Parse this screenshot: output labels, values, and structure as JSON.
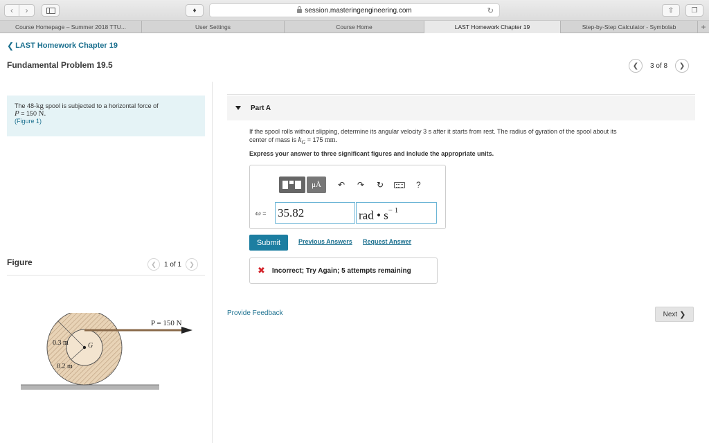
{
  "browser": {
    "url": "session.masteringengineering.com",
    "tabs": [
      {
        "label": "Course Homepage – Summer 2018 TTU..."
      },
      {
        "label": "User Settings"
      },
      {
        "label": "Course Home"
      },
      {
        "label": "LAST Homework Chapter 19"
      },
      {
        "label": "Step-by-Step Calculator - Symbolab"
      }
    ],
    "new_tab_label": "+"
  },
  "header": {
    "back_link": "LAST Homework Chapter 19",
    "title": "Fundamental Problem 19.5",
    "pager_text": "3 of 8"
  },
  "problem": {
    "line1_pre": "The 48-",
    "line1_unit": "kg",
    "line1_post": " spool is subjected to a horizontal force of",
    "line2_var": "P",
    "line2_post": " = 150 ",
    "line2_unit": "N.",
    "figure_link": "(Figure 1)"
  },
  "figure": {
    "label": "Figure",
    "pager_text": "1 of 1",
    "labels": {
      "force": "P = 150 N",
      "outer_radius": "0.3 m",
      "inner_radius": "0.2 m",
      "center": "G"
    }
  },
  "part": {
    "label": "Part A",
    "question_line1": "If the spool rolls without slipping, determine its angular velocity 3 s after it starts from rest. The radius of gyration of the spool about its",
    "question_line2_pre": "center of mass is ",
    "question_var": "k",
    "question_sub": "G",
    "question_eq": " = 175 ",
    "question_unit": "mm.",
    "instruction": "Express your answer to three significant figures and include the appropriate units.",
    "answer": {
      "var_label": "ω",
      "equals": " =",
      "value": "35.82",
      "unit_main": "rad • s",
      "unit_exp": "− 1"
    },
    "tool_mu_label": "μÅ",
    "help_label": "?",
    "submit_label": "Submit",
    "previous_answers": "Previous Answers",
    "request_answer": "Request Answer",
    "feedback": "Incorrect; Try Again; 5 attempts remaining"
  },
  "footer": {
    "provide_feedback": "Provide Feedback",
    "next_label": "Next"
  }
}
